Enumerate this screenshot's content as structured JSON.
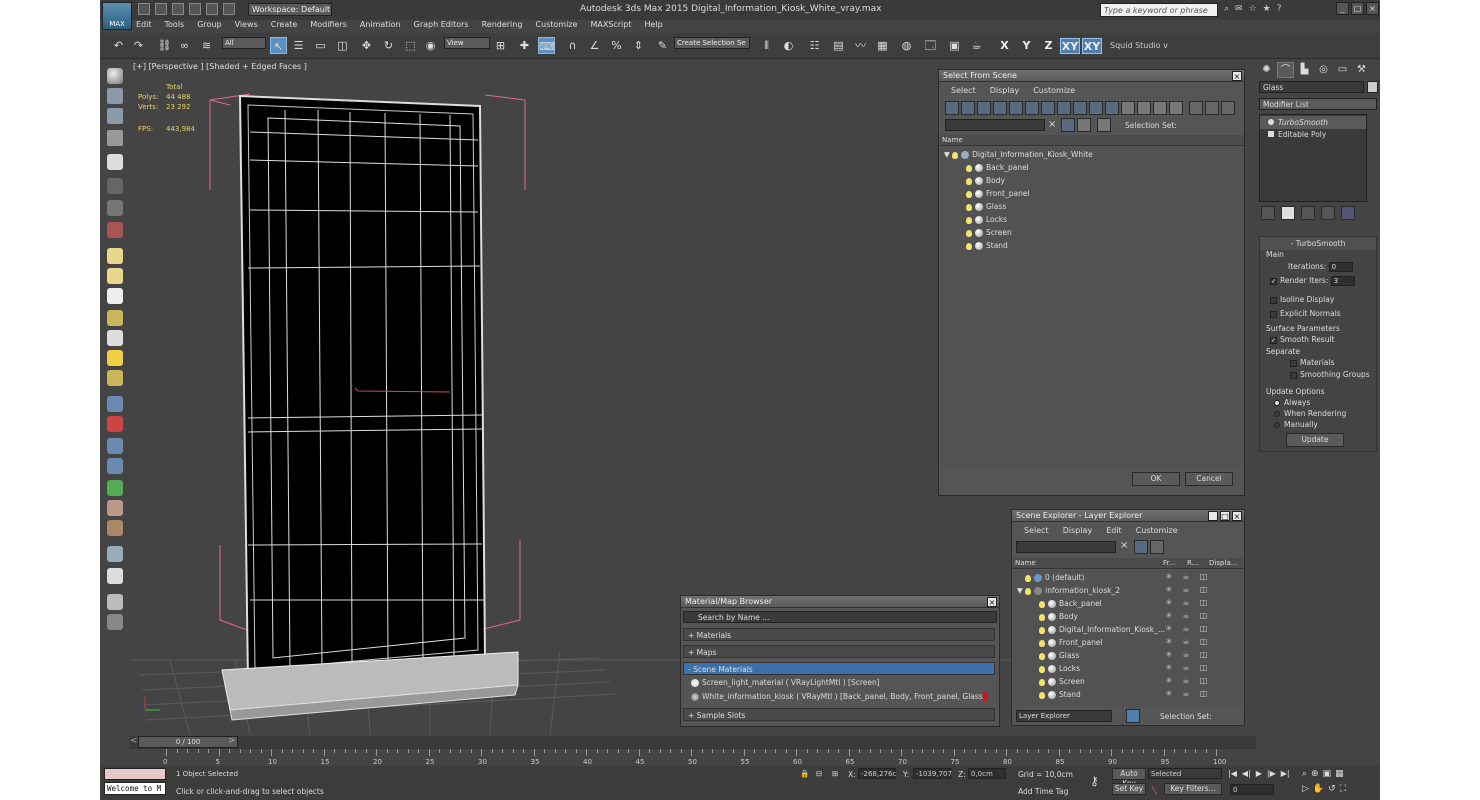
{
  "app": {
    "title": "Autodesk 3ds Max  2015    Digital_Information_Kiosk_White_vray.max",
    "logo": "MAX",
    "workspace": "Workspace: Default",
    "search_placeholder": "Type a keyword or phrase",
    "menu": [
      "Edit",
      "Tools",
      "Group",
      "Views",
      "Create",
      "Modifiers",
      "Animation",
      "Graph Editors",
      "Rendering",
      "Customize",
      "MAXScript",
      "Help"
    ]
  },
  "toolbar": {
    "selection_filter": "All",
    "ref_coord": "View",
    "named_selection": "Create Selection Se",
    "axes": [
      "X",
      "Y",
      "Z",
      "XY",
      "XY"
    ],
    "squid": "Squid Studio v"
  },
  "viewport": {
    "label": "[+] [Perspective ] [Shaded + Edged Faces ]",
    "stats_header": "Total",
    "stats": [
      {
        "k": "Polys:",
        "v": "44 488"
      },
      {
        "k": "Verts:",
        "v": "23 292"
      },
      {
        "k": "FPS:",
        "v": "443,984"
      }
    ]
  },
  "select_from_scene": {
    "title": "Select From Scene",
    "menu": [
      "Select",
      "Display",
      "Customize"
    ],
    "selection_set_label": "Selection Set:",
    "column": "Name",
    "root": "Digital_Information_Kiosk_White",
    "items": [
      "Back_panel",
      "Body",
      "Front_panel",
      "Glass",
      "Locks",
      "Screen",
      "Stand"
    ],
    "ok": "OK",
    "cancel": "Cancel"
  },
  "scene_explorer": {
    "title": "Scene Explorer - Layer Explorer",
    "menu": [
      "Select",
      "Display",
      "Edit",
      "Customize"
    ],
    "columns": [
      "Name",
      "Fr...",
      "R...",
      "Displa..."
    ],
    "rows": [
      {
        "label": "0 (default)",
        "indent": 1
      },
      {
        "label": "information_kiosk_2",
        "indent": 1
      },
      {
        "label": "Back_panel",
        "indent": 2
      },
      {
        "label": "Body",
        "indent": 2
      },
      {
        "label": "Digital_Information_Kiosk_...",
        "indent": 2
      },
      {
        "label": "Front_panel",
        "indent": 2
      },
      {
        "label": "Glass",
        "indent": 2
      },
      {
        "label": "Locks",
        "indent": 2
      },
      {
        "label": "Screen",
        "indent": 2
      },
      {
        "label": "Stand",
        "indent": 2
      }
    ],
    "footer_dropdown": "Layer Explorer",
    "footer_selection": "Selection Set:"
  },
  "material_browser": {
    "title": "Material/Map Browser",
    "search": "Search by Name ...",
    "sections": {
      "materials": "+ Materials",
      "maps": "+ Maps",
      "scene": "- Scene Materials",
      "slots": "+ Sample Slots"
    },
    "scene_items": [
      "Screen_light_material  ( VRayLightMtl ) [Screen]",
      "White_information_kiosk  ( VRayMtl ) [Back_panel, Body, Front_panel, Glass, Lo..."
    ]
  },
  "command_panel": {
    "object_name": "Glass",
    "modifier_list": "Modifier List",
    "stack": [
      "TurboSmooth",
      "Editable Poly"
    ],
    "rollout_title": "TurboSmooth",
    "main": "Main",
    "iterations_label": "Iterations:",
    "iterations": "0",
    "render_iters_label": "Render Iters:",
    "render_iters": "3",
    "isoline": "Isoline Display",
    "explicit": "Explicit Normals",
    "surface_params": "Surface Parameters",
    "smooth_result": "Smooth Result",
    "separate": "Separate",
    "materials": "Materials",
    "smoothing_groups": "Smoothing Groups",
    "update_options": "Update Options",
    "always": "Always",
    "when_rendering": "When Rendering",
    "manually": "Manually",
    "update_button": "Update"
  },
  "timeline": {
    "frame": "0 / 100",
    "ticks": [
      "0",
      "5",
      "10",
      "15",
      "20",
      "25",
      "30",
      "35",
      "40",
      "45",
      "50",
      "55",
      "60",
      "65",
      "70",
      "75",
      "80",
      "85",
      "90",
      "95",
      "100"
    ]
  },
  "status": {
    "listener": "Welcome to M",
    "selected": "1 Object Selected",
    "prompt": "Click or click-and-drag to select objects",
    "x": "-268,276c",
    "y": "-1039,707",
    "z": "0,0cm",
    "grid": "Grid = 10,0cm",
    "add_time_tag": "Add Time Tag",
    "auto_key": "Auto Key",
    "set_key": "Set Key",
    "key_mode": "Selected",
    "key_filters": "Key Filters...",
    "frame_field": "0"
  }
}
